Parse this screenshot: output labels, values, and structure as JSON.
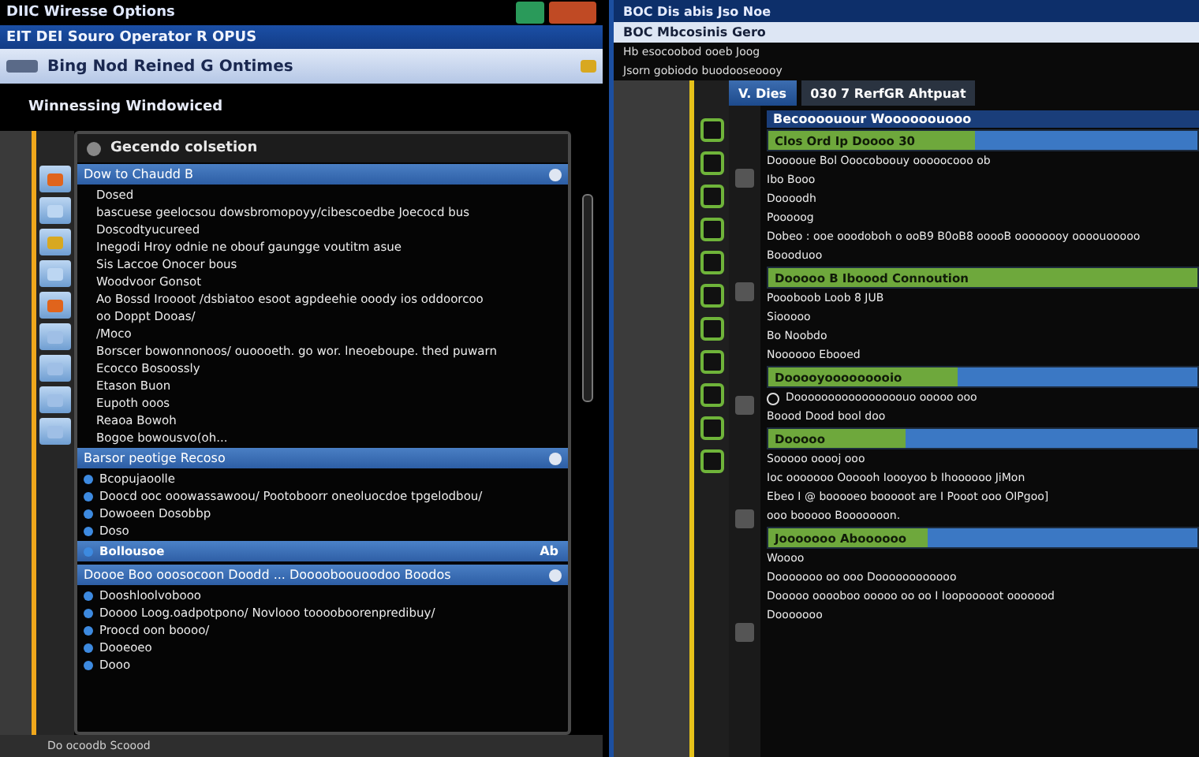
{
  "left_window": {
    "title": "DIIC Wiresse Options",
    "menu_bar": "EIT DEI Souro Operator R OPUS",
    "header": "Bing Nod Reined G Ontimes",
    "subheading": "Winnessing Windowiced",
    "panel_title": "Gecendo colsetion",
    "sections": [
      {
        "title": "Dow to Chaudd B",
        "items": [
          {
            "text": "Dosed",
            "selected": false
          },
          {
            "text": "bascuese geelocsou dowsbromopoyy/cibescoedbe Joecocd bus",
            "selected": false
          },
          {
            "text": "Doscodtyucureed",
            "selected": false
          },
          {
            "text": "Inegodi Hroy odnie ne obouf gaungge voutitm asue",
            "selected": false
          },
          {
            "text": "Sis Laccoe Onocer bous",
            "selected": false
          },
          {
            "text": "Woodvoor Gonsot",
            "selected": false
          },
          {
            "text": "Ao Bossd Iroooot /dsbiatoo esoot agpdeehie ooody ios oddoorcoo",
            "selected": false
          },
          {
            "text": "oo Doppt Dooas/",
            "selected": false
          },
          {
            "text": "/Moco",
            "selected": false
          },
          {
            "text": "Borscer bowonnonoos/ ouoooeth. go wor. lneoeboupe. thed puwarn",
            "selected": false
          },
          {
            "text": "Ecocco Bosoossly",
            "selected": false
          },
          {
            "text": "Etason Buon",
            "selected": false
          },
          {
            "text": "Eupoth ooos",
            "selected": false
          },
          {
            "text": "Reaoa Bowoh",
            "selected": false
          },
          {
            "text": "Bogoe bowousvo(oh...",
            "selected": false
          }
        ]
      },
      {
        "title": "Barsor peotige Recoso",
        "items": [
          {
            "text": "Bcopujaoolle",
            "selected": false
          },
          {
            "text": "Doocd ooc ooowassawoou/ Pootoboorr oneoluocdoe tpgelodbou/",
            "selected": false
          },
          {
            "text": "Dowoeen Dosobbp",
            "selected": false
          },
          {
            "text": "Doso",
            "selected": false
          },
          {
            "text": "Bollousoe",
            "badge": "Ab",
            "selected": true
          }
        ]
      },
      {
        "title": "Doooe Boo ooosocoon Doodd ... Dooooboouoodoo Boodos",
        "items": [
          {
            "text": "Dooshloolvobooo",
            "selected": false
          },
          {
            "text": "Doooo Loog.oadpotpono/ Novlooo tooooboorenpredibuy/",
            "selected": false
          },
          {
            "text": "Proocd oon boooo/",
            "selected": false
          },
          {
            "text": "Dooeoeo",
            "selected": false
          },
          {
            "text": "Dooo",
            "selected": false
          }
        ]
      }
    ],
    "status_bar": "Do ocoodb Scoood"
  },
  "right_window": {
    "title": "BOC Dis abis Jso Noe",
    "header": "BOC Mbcosinis Gero",
    "lines": [
      "Hb esocoobod ooeb Joog",
      "Jsorn gobiodo buodooseoooy"
    ],
    "tabs": [
      {
        "label": "V. Dies",
        "selected": true
      },
      {
        "label": "030 7 RerfGR Ahtpuat",
        "selected": false
      }
    ],
    "blocks": [
      {
        "kind": "heading",
        "text": "Becoooouour Woooooouooo"
      },
      {
        "kind": "progress",
        "text": "Clos Ord Ip Doooo 30",
        "level": 0.48
      },
      {
        "kind": "text",
        "text": "Dooooue Bol Ooocoboouy ooooocooo ob"
      },
      {
        "kind": "text",
        "text": "Ibo Booo"
      },
      {
        "kind": "text",
        "text": "Doooodh"
      },
      {
        "kind": "text",
        "text": "Pooooog"
      },
      {
        "kind": "text",
        "text": "Dobeo : ooe ooodoboh o ooB9 B0oB8 ooooB oooooooy oooouooooo"
      },
      {
        "kind": "text",
        "text": "Boooduoo"
      },
      {
        "kind": "progress",
        "text": "Dooooo B Iboood Connoution",
        "level": 1
      },
      {
        "kind": "text",
        "text": "Poooboob Loob 8 JUB"
      },
      {
        "kind": "text",
        "text": "Siooooo"
      },
      {
        "kind": "text",
        "text": "Bo Noobdo"
      },
      {
        "kind": "text",
        "text": "Noooooo Ebooed"
      },
      {
        "kind": "progress",
        "text": "Dooooyooooooooio",
        "level": 0.44
      },
      {
        "kind": "option",
        "text": "Doooooooooooooooouo ooooo ooo",
        "selected": false
      },
      {
        "kind": "text",
        "text": "Boood Dood bool doo"
      },
      {
        "kind": "progress",
        "text": "Dooooo",
        "level": 0.32
      },
      {
        "kind": "text",
        "text": "Sooooo ooooj ooo"
      },
      {
        "kind": "text",
        "text": "Ioc ooooooo Oooooh Ioooyoo b Ihoooooo JiMon"
      },
      {
        "kind": "text",
        "text": "Ebeo I @ booooeo booooot are I Pooot ooo OIPgoo]"
      },
      {
        "kind": "text",
        "text": "ooo booooo Booooooon."
      },
      {
        "kind": "progress",
        "text": "Jooooooo Aboooooo",
        "level": 0.37
      },
      {
        "kind": "text",
        "text": "Woooo"
      },
      {
        "kind": "text",
        "text": "Dooooooo oo ooo Doooooooooooo"
      },
      {
        "kind": "text",
        "text": "Dooooo ooooboo ooooo oo oo I Ioopooooot ooooood"
      },
      {
        "kind": "text",
        "text": "Dooooooo"
      }
    ]
  }
}
